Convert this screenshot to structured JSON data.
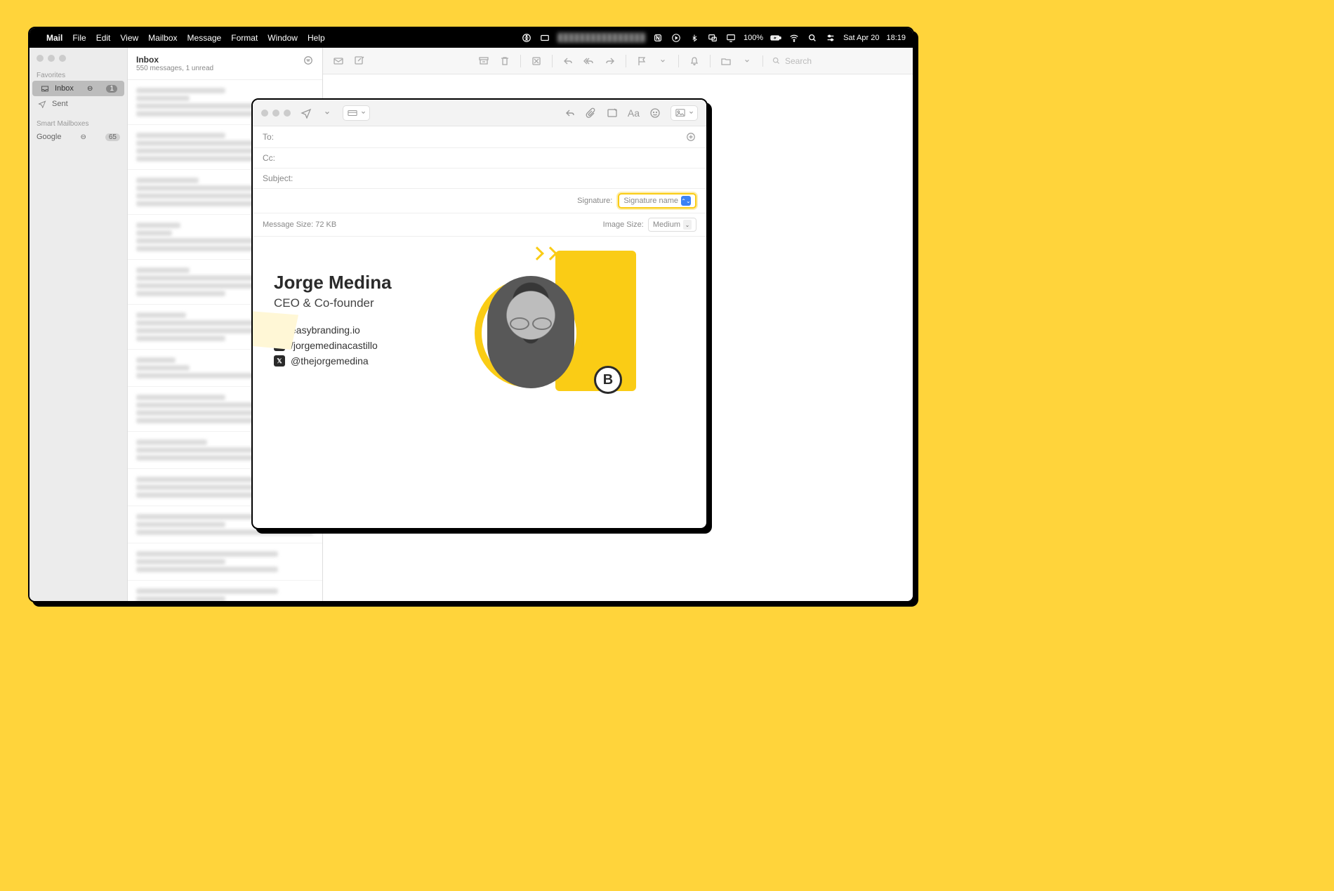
{
  "menubar": {
    "app": "Mail",
    "items": [
      "File",
      "Edit",
      "View",
      "Mailbox",
      "Message",
      "Format",
      "Window",
      "Help"
    ],
    "battery": "100%",
    "date": "Sat Apr 20",
    "time": "18:19"
  },
  "sidebar": {
    "favorites_label": "Favorites",
    "inbox": {
      "label": "Inbox",
      "count": "1"
    },
    "sent": {
      "label": "Sent"
    },
    "smart_label": "Smart Mailboxes",
    "google": {
      "label": "Google",
      "count": "65"
    }
  },
  "msglist": {
    "title": "Inbox",
    "subtitle": "550 messages, 1 unread"
  },
  "reader_toolbar": {
    "search_placeholder": "Search"
  },
  "compose": {
    "to_label": "To:",
    "cc_label": "Cc:",
    "subject_label": "Subject:",
    "signature_label": "Signature:",
    "signature_value": "Signature name",
    "message_size_label": "Message Size:",
    "message_size_value": "72 KB",
    "image_size_label": "Image Size:",
    "image_size_value": "Medium"
  },
  "signature": {
    "name": "Jorge Medina",
    "title": "CEO & Co-founder",
    "website": "easybranding.io",
    "linkedin": "/jorgemedinacastillo",
    "twitter": "@thejorgemedina",
    "badge_letter": "B"
  }
}
